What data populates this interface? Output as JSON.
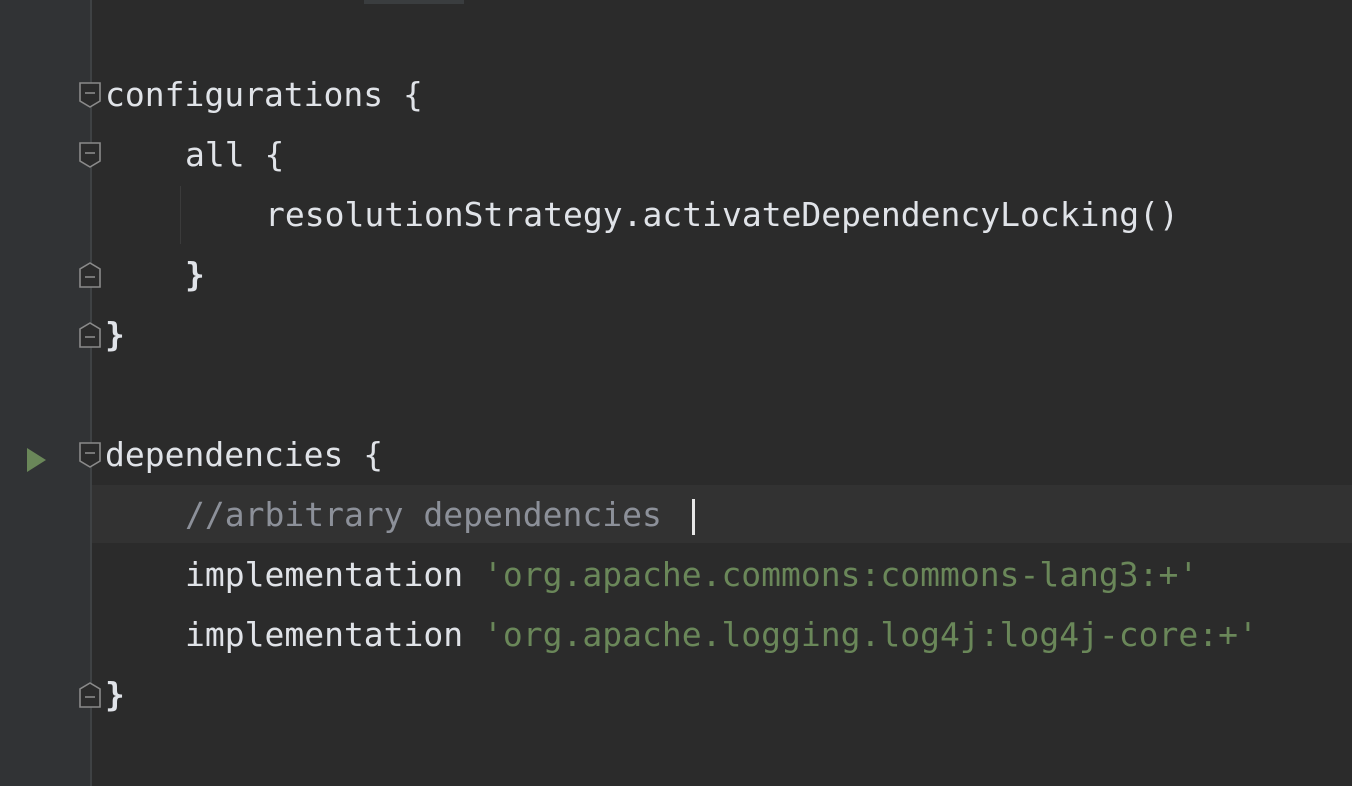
{
  "editor": {
    "lines": {
      "l1": {
        "text": "configurations {"
      },
      "l2": {
        "text": "all {"
      },
      "l3": {
        "text": "resolutionStrategy.activateDependencyLocking()"
      },
      "l4": {
        "text": "}"
      },
      "l5": {
        "text": "}"
      },
      "l6": {
        "text": "dependencies {"
      },
      "l7": {
        "text": "//arbitrary dependencies "
      },
      "l8": {
        "keyword": "implementation",
        "string": "'org.apache.commons:commons-lang3:+'"
      },
      "l9": {
        "keyword": "implementation",
        "string": "'org.apache.logging.log4j:log4j-core:+'"
      },
      "l10": {
        "text": "}"
      }
    }
  },
  "colors": {
    "background": "#2b2b2b",
    "gutter": "#313335",
    "current_line": "#323232",
    "text": "#a9b7c6",
    "comment": "#8c9099",
    "string": "#6a8759",
    "run_icon": "#6a8759"
  },
  "icons": {
    "fold": "fold-marker-icon",
    "run": "run-gutter-icon"
  }
}
